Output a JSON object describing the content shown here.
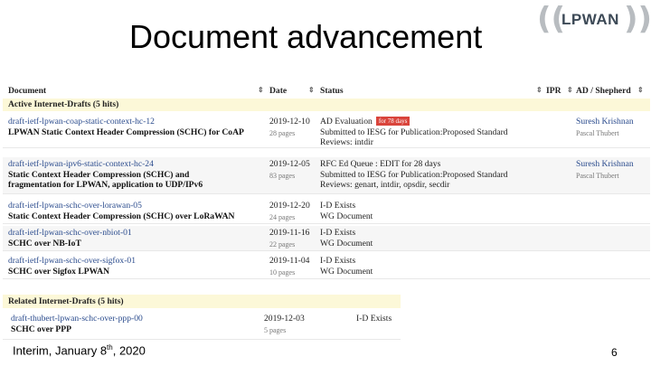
{
  "slide": {
    "title": "Document advancement",
    "logo_text": "LPWAN",
    "footer_prefix": "Interim, January 8",
    "footer_sup": "th",
    "footer_suffix": ", 2020",
    "page_number": "6"
  },
  "table": {
    "headers": [
      "Document",
      "Date",
      "Status",
      "IPR",
      "AD / Shepherd"
    ],
    "sort_glyph": "⇕",
    "group_label": "Active Internet-Drafts (5 hits)",
    "rows": [
      {
        "name": "draft-ietf-lpwan-coap-static-context-hc-12",
        "title1": "LPWAN Static Context Header Compression (SCHC) for CoAP",
        "title2": "",
        "date": "2019-12-10",
        "pages": "28 pages",
        "status1": "AD Evaluation",
        "badge": "for 78 days",
        "status2": "Submitted to IESG for Publication:Proposed Standard",
        "status3": "Reviews: intdir",
        "ad": "Suresh Krishnan",
        "shepherd": "Pascal Thubert"
      },
      {
        "name": "draft-ietf-lpwan-ipv6-static-context-hc-24",
        "title1": "Static Context Header Compression (SCHC) and",
        "title2": "fragmentation for LPWAN, application to UDP/IPv6",
        "date": "2019-12-05",
        "pages": "83 pages",
        "status1": "RFC Ed Queue : EDIT for 28 days",
        "badge": "",
        "status2": "Submitted to IESG for Publication:Proposed Standard",
        "status3": "Reviews: genart, intdir, opsdir, secdir",
        "ad": "Suresh Krishnan",
        "shepherd": "Pascal Thubert"
      },
      {
        "name": "draft-ietf-lpwan-schc-over-lorawan-05",
        "title1": "Static Context Header Compression (SCHC) over LoRaWAN",
        "title2": "",
        "date": "2019-12-20",
        "pages": "24 pages",
        "status1": "I-D Exists",
        "badge": "",
        "status2": "WG Document",
        "status3": "",
        "ad": "",
        "shepherd": ""
      },
      {
        "name": "draft-ietf-lpwan-schc-over-nbiot-01",
        "title1": "SCHC over NB-IoT",
        "title2": "",
        "date": "2019-11-16",
        "pages": "22 pages",
        "status1": "I-D Exists",
        "badge": "",
        "status2": "WG Document",
        "status3": "",
        "ad": "",
        "shepherd": ""
      },
      {
        "name": "draft-ietf-lpwan-schc-over-sigfox-01",
        "title1": "SCHC over Sigfox LPWAN",
        "title2": "",
        "date": "2019-11-04",
        "pages": "10 pages",
        "status1": "I-D Exists",
        "badge": "",
        "status2": "WG Document",
        "status3": "",
        "ad": "",
        "shepherd": ""
      }
    ]
  },
  "related": {
    "group_label": "Related Internet-Drafts (5 hits)",
    "rows": [
      {
        "name": "draft-thubert-lpwan-schc-over-ppp-00",
        "title1": "SCHC over PPP",
        "date": "2019-12-03",
        "pages": "5 pages",
        "status1": "I-D Exists"
      }
    ]
  }
}
